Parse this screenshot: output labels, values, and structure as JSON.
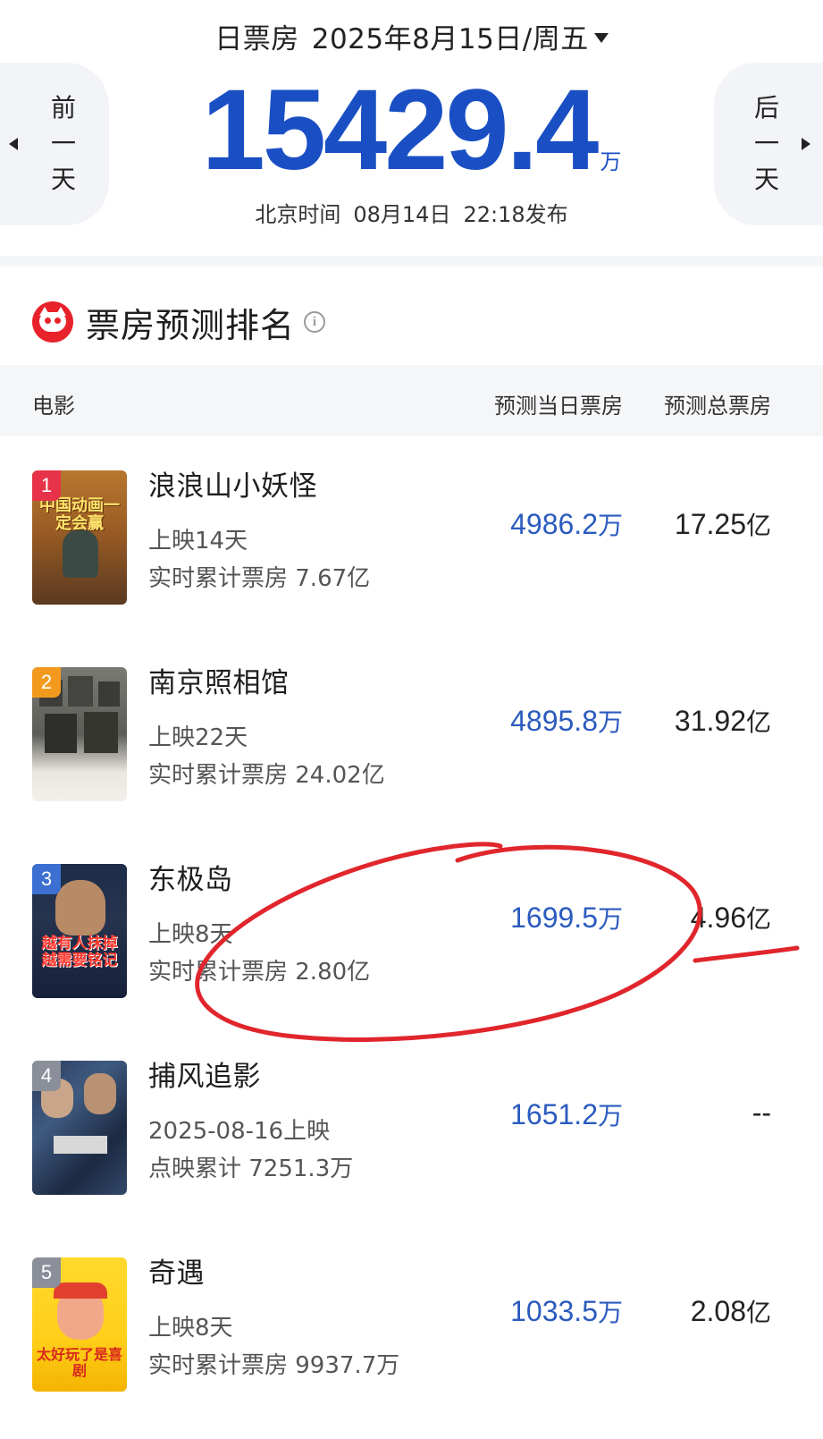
{
  "header": {
    "label": "日票房",
    "date": "2025年8月15日/周五",
    "prev_day": "前一天",
    "next_day": "后一天",
    "total_amount": "15429.4",
    "total_unit": "万",
    "publish_prefix": "北京时间",
    "publish_date": "08月14日",
    "publish_time": "22:18发布"
  },
  "section": {
    "title": "票房预测排名",
    "info_icon": "i"
  },
  "table": {
    "col_movie": "电影",
    "col_day": "预测当日票房",
    "col_total": "预测总票房"
  },
  "movies": [
    {
      "rank": "1",
      "name": "浪浪山小妖怪",
      "sub1": "上映14天",
      "sub2": "实时累计票房 7.67亿",
      "day_value": "4986.2",
      "day_unit": "万",
      "total_value": "17.25",
      "total_unit": "亿",
      "poster_caption": "中国动画一定会赢",
      "rank_color": "#e8324a"
    },
    {
      "rank": "2",
      "name": "南京照相馆",
      "sub1": "上映22天",
      "sub2": "实时累计票房 24.02亿",
      "day_value": "4895.8",
      "day_unit": "万",
      "total_value": "31.92",
      "total_unit": "亿",
      "poster_caption": "",
      "rank_color": "#f39a1e"
    },
    {
      "rank": "3",
      "name": "东极岛",
      "sub1": "上映8天",
      "sub2": "实时累计票房 2.80亿",
      "day_value": "1699.5",
      "day_unit": "万",
      "total_value": "4.96",
      "total_unit": "亿",
      "poster_caption": "越有人抹掉越需要铭记",
      "rank_color": "#3b6fd1"
    },
    {
      "rank": "4",
      "name": "捕风追影",
      "sub1": "2025-08-16上映",
      "sub2": "点映累计 7251.3万",
      "day_value": "1651.2",
      "day_unit": "万",
      "total_value": "--",
      "total_unit": "",
      "poster_caption": "",
      "rank_color": "#8a8f99"
    },
    {
      "rank": "5",
      "name": "奇遇",
      "sub1": "上映8天",
      "sub2": "实时累计票房 9937.7万",
      "day_value": "1033.5",
      "day_unit": "万",
      "total_value": "2.08",
      "total_unit": "亿",
      "poster_caption": "太好玩了是喜剧",
      "rank_color": "#8a8f99"
    }
  ],
  "colors": {
    "accent_blue": "#1a4fc4",
    "value_blue": "#2b5bbf",
    "annotation_red": "#e0262c",
    "maoyan_red": "#e8222b"
  },
  "icons": {
    "logo": "maoyan-cat-logo-icon",
    "info": "info-circle-icon",
    "prev": "caret-left-icon",
    "next": "caret-right-icon",
    "dropdown": "caret-down-icon"
  }
}
